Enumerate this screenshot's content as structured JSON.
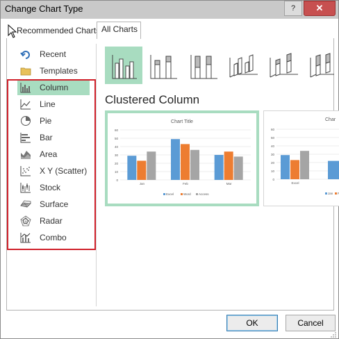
{
  "window": {
    "title": "Change Chart Type",
    "help_glyph": "?",
    "close_glyph": "✕"
  },
  "tabs": [
    {
      "label": "Recommended Charts",
      "selected": false
    },
    {
      "label": "All Charts",
      "selected": true
    }
  ],
  "categories": [
    {
      "label": "Recent",
      "icon": "recent-icon"
    },
    {
      "label": "Templates",
      "icon": "folder-icon"
    },
    {
      "label": "Column",
      "icon": "column-chart-icon",
      "selected": true
    },
    {
      "label": "Line",
      "icon": "line-chart-icon"
    },
    {
      "label": "Pie",
      "icon": "pie-chart-icon"
    },
    {
      "label": "Bar",
      "icon": "bar-chart-icon"
    },
    {
      "label": "Area",
      "icon": "area-chart-icon"
    },
    {
      "label": "X Y (Scatter)",
      "icon": "scatter-chart-icon"
    },
    {
      "label": "Stock",
      "icon": "stock-chart-icon"
    },
    {
      "label": "Surface",
      "icon": "surface-chart-icon"
    },
    {
      "label": "Radar",
      "icon": "radar-chart-icon"
    },
    {
      "label": "Combo",
      "icon": "combo-chart-icon"
    }
  ],
  "subtypes": [
    {
      "name": "clustered-column",
      "selected": true
    },
    {
      "name": "stacked-column"
    },
    {
      "name": "100-stacked-column"
    },
    {
      "name": "3d-clustered-column"
    },
    {
      "name": "3d-stacked-column"
    },
    {
      "name": "3d-100-stacked-column"
    }
  ],
  "selected_subtype_name": "Clustered Column",
  "preview": {
    "chart_title": "Chart Title",
    "chart_title_partial": "Char",
    "y_ticks": [
      "60",
      "50",
      "40",
      "30",
      "20",
      "10",
      "0"
    ],
    "categories": [
      "Jan",
      "Feb",
      "Mar"
    ],
    "series": [
      {
        "name": "Excel",
        "color": "#5b9bd5",
        "values": [
          29,
          49,
          30
        ]
      },
      {
        "name": "Word",
        "color": "#ed7d31",
        "values": [
          23,
          43,
          34
        ]
      },
      {
        "name": "Access",
        "color": "#a5a5a5",
        "values": [
          34,
          36,
          28
        ]
      }
    ],
    "second_preview": {
      "x_label": "Excel",
      "y_ticks": [
        "60",
        "50",
        "40",
        "30",
        "20",
        "10",
        "0"
      ],
      "legend": [
        "Jan",
        "Fe"
      ]
    }
  },
  "colors": {
    "selection": "#a8dcc0",
    "highlight_border": "#d0202a",
    "close_red": "#c75050"
  },
  "buttons": {
    "ok": "OK",
    "cancel": "Cancel"
  }
}
